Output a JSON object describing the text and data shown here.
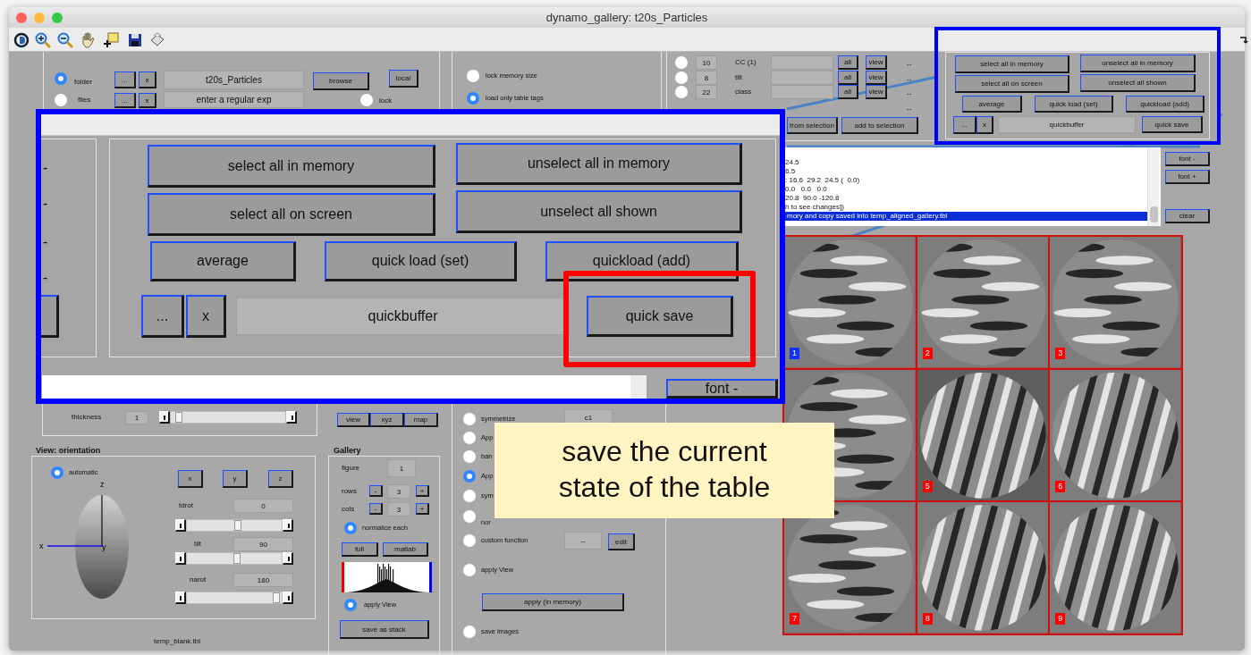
{
  "window": {
    "title": "dynamo_gallery: t20s_Particles"
  },
  "project": {
    "sources": [
      {
        "label": "folder",
        "selected": true
      },
      {
        "label": "files",
        "selected": false
      }
    ],
    "folder_buttons": [
      "...",
      "x"
    ],
    "folder_field": "t20s_Particles",
    "browse": "browse",
    "local": "local",
    "files_buttons": [
      "...",
      "x"
    ],
    "files_field": "enter a regular exp",
    "lock": {
      "label": "lock",
      "selected": false
    }
  },
  "memory_options": [
    {
      "label": "lock memory size",
      "selected": false
    },
    {
      "label": "load only table tags",
      "selected": true
    }
  ],
  "filters": {
    "rows": [
      {
        "selected": false,
        "count": "10",
        "label": "CC (1)",
        "all": "all",
        "view": "view",
        "reading": "--"
      },
      {
        "selected": false,
        "count": "8",
        "label": "tilt",
        "all": "all",
        "view": "view",
        "reading": "--"
      },
      {
        "selected": false,
        "count": "22",
        "label": "class",
        "all": "all",
        "view": "view",
        "reading": "--"
      }
    ],
    "extra_reading": "--",
    "selection_buttons": [
      "from selection",
      "add to selection"
    ]
  },
  "quick_panel": {
    "rows": [
      [
        "select all in memory",
        "unselect all in memory"
      ],
      [
        "select all on screen",
        "unselect all shown"
      ],
      [
        "average",
        "quick load (set)",
        "quickload (add)"
      ]
    ],
    "browse": "...",
    "clear": "x",
    "buffer": "quickbuffer",
    "save": "quick save"
  },
  "zoom_callout": {
    "readings": [
      "-",
      "-",
      "-",
      "-"
    ],
    "rows": [
      [
        "select all in memory",
        "unselect all in memory"
      ],
      [
        "select all on screen",
        "unselect all shown"
      ],
      [
        "average",
        "quick load (set)",
        "quickload (add)"
      ]
    ],
    "browse": "...",
    "clear": "x",
    "buffer": "quickbuffer",
    "save": "quick save",
    "font_button": "font -"
  },
  "log": {
    "lines": [
      {
        "text": "24.5",
        "selected": false
      },
      {
        "text": "6.5",
        "selected": false
      },
      {
        "text": ": 16.6  29.2  24.5 (  0.0)",
        "selected": false
      },
      {
        "text": "0.0   0.0   0.0",
        "selected": false
      },
      {
        "text": "20.8  90.0 -120.8",
        "selected": false
      },
      {
        "text": "h to see changes])",
        "selected": false
      },
      {
        "text": "mory and copy saved into temp_aligned_gallery.tbl",
        "selected": true
      }
    ],
    "buttons": [
      "font -",
      "font +",
      "clear"
    ]
  },
  "particles": [
    {
      "kind": "blobs",
      "number": "1",
      "selected": true
    },
    {
      "kind": "blobs",
      "number": "2",
      "selected": false
    },
    {
      "kind": "blobs",
      "number": "3",
      "selected": false
    },
    {
      "kind": "blobs"
    },
    {
      "kind": "stripes",
      "number": "5",
      "selected": false
    },
    {
      "kind": "stripes",
      "number": "6",
      "selected": false
    },
    {
      "kind": "blobs",
      "number": "7",
      "selected": false
    },
    {
      "kind": "stripes",
      "number": "8",
      "selected": false
    },
    {
      "kind": "stripes",
      "number": "9",
      "selected": false
    }
  ],
  "thickness": {
    "label": "thickness",
    "value": "1",
    "level": 0.04
  },
  "orientation": {
    "title": "View: orientation",
    "automatic": {
      "label": "automatic",
      "selected": true
    },
    "axes": [
      "z",
      "x",
      "y"
    ],
    "axis_buttons": [
      "x",
      "y",
      "z"
    ],
    "angles": [
      {
        "label": "tdrot",
        "value": "0",
        "level": 0.53
      },
      {
        "label": "tilt",
        "value": "90",
        "level": 0.52
      },
      {
        "label": "narot",
        "value": "180",
        "level": 0.96
      }
    ]
  },
  "file_label": "temp_blank.tbl",
  "view_buttons": [
    "view",
    "xyz",
    "map"
  ],
  "gallery": {
    "title": "Gallery",
    "figure": {
      "label": "figure",
      "value": "1"
    },
    "grid": [
      {
        "label": "rows",
        "minus": "-",
        "value": "3",
        "plus": "+"
      },
      {
        "label": "cols",
        "minus": "-",
        "value": "3",
        "plus": "+"
      }
    ],
    "normalize": {
      "label": "normalice each",
      "selected": true
    },
    "buttons": [
      "full",
      "matlab"
    ],
    "apply_view": {
      "label": "apply View",
      "selected": true
    },
    "save": "save as stack"
  },
  "operations": {
    "options": [
      {
        "label": "symmetrize",
        "selected": false
      },
      {
        "label": "App",
        "selected": false
      },
      {
        "label": "ban",
        "selected": false
      },
      {
        "label": "App",
        "selected": true
      },
      {
        "label": "sym",
        "selected": false
      },
      {
        "label": "nor",
        "selected": false
      },
      {
        "label": "custom function",
        "selected": false
      },
      {
        "label": "apply View",
        "selected": false
      }
    ],
    "symmetry_field": "c1",
    "function_field": "--",
    "edit": "edit",
    "apply": "apply (in memory)",
    "save_images": {
      "label": "save images",
      "selected": false
    }
  },
  "tooltip": {
    "text": "save the current state of the table"
  }
}
